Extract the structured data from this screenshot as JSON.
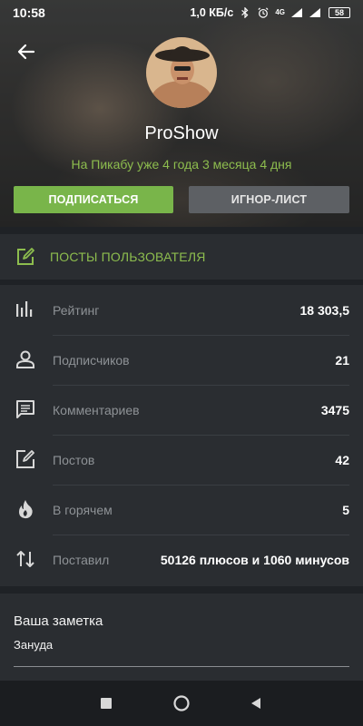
{
  "status_bar": {
    "time": "10:58",
    "speed": "1,0 КБ/с",
    "network": "4G",
    "battery": "58"
  },
  "profile": {
    "username": "ProShow",
    "since": "На Пикабу уже 4 года 3 месяца 4 дня",
    "subscribe_label": "ПОДПИСАТЬСЯ",
    "ignore_label": "ИГНОР-ЛИСТ"
  },
  "posts_link": {
    "label": "ПОСТЫ ПОЛЬЗОВАТЕЛЯ",
    "icon": "edit-icon"
  },
  "stats": [
    {
      "label": "Рейтинг",
      "value": "18 303,5",
      "icon": "rating-bars-icon"
    },
    {
      "label": "Подписчиков",
      "value": "21",
      "icon": "person-icon"
    },
    {
      "label": "Комментариев",
      "value": "3475",
      "icon": "comment-icon"
    },
    {
      "label": "Постов",
      "value": "42",
      "icon": "edit-icon"
    },
    {
      "label": "В горячем",
      "value": "5",
      "icon": "flame-icon"
    },
    {
      "label": "Поставил",
      "value": "50126 плюсов и 1060 минусов",
      "icon": "arrows-updown-icon"
    }
  ],
  "note": {
    "title": "Ваша заметка",
    "text": "Зануда"
  },
  "colors": {
    "accent_green": "#79b54a",
    "link_green": "#8dbd4e",
    "background": "#1f2226",
    "card": "#2a2d31"
  }
}
